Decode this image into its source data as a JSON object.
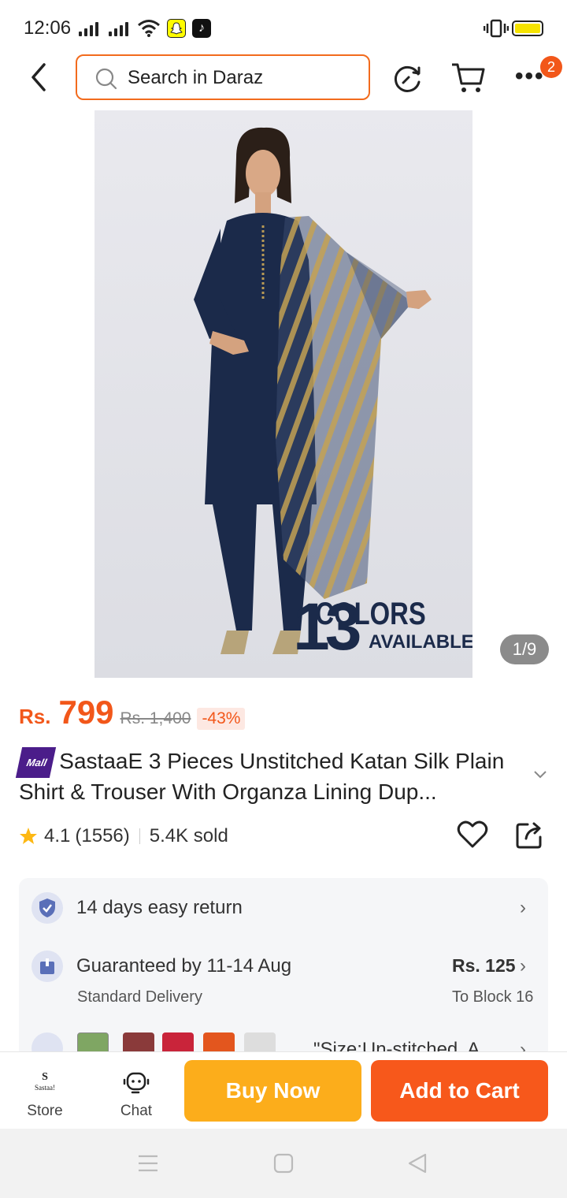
{
  "status_bar": {
    "time": "12:06"
  },
  "search": {
    "placeholder": "Search in Daraz"
  },
  "header": {
    "more_badge_count": "2"
  },
  "hero_image": {
    "overlay_number": "13",
    "overlay_line1": "COLORS",
    "overlay_line2": "AVAILABLE",
    "counter": "1/9"
  },
  "price": {
    "currency": "Rs.",
    "current": "799",
    "original": "Rs. 1,400",
    "discount": "-43%"
  },
  "product": {
    "badge": "Mall",
    "title": "SastaaE 3 Pieces Unstitched Katan Silk Plain Shirt & Trouser With Organza Lining Dup..."
  },
  "rating": {
    "score": "4.1",
    "count": "(1556)",
    "sold": "5.4K sold"
  },
  "services": {
    "return_text": "14 days easy return",
    "delivery_text": "Guaranteed by 11-14 Aug",
    "delivery_sub": "Standard Delivery",
    "delivery_price": "Rs. 125",
    "delivery_location": "To Block 16",
    "variant_text": "\"Size:Un-stitched, A..."
  },
  "bottom_bar": {
    "store_logo": "S",
    "store_logo_sub": "Sastaa!",
    "store_label": "Store",
    "chat_label": "Chat",
    "buy_now": "Buy Now",
    "add_to_cart": "Add to Cart"
  },
  "colors": {
    "accent": "#f2571a",
    "buy_now": "#fcad1b",
    "add_to_cart": "#f7581b",
    "navy": "#1b2a4a"
  }
}
